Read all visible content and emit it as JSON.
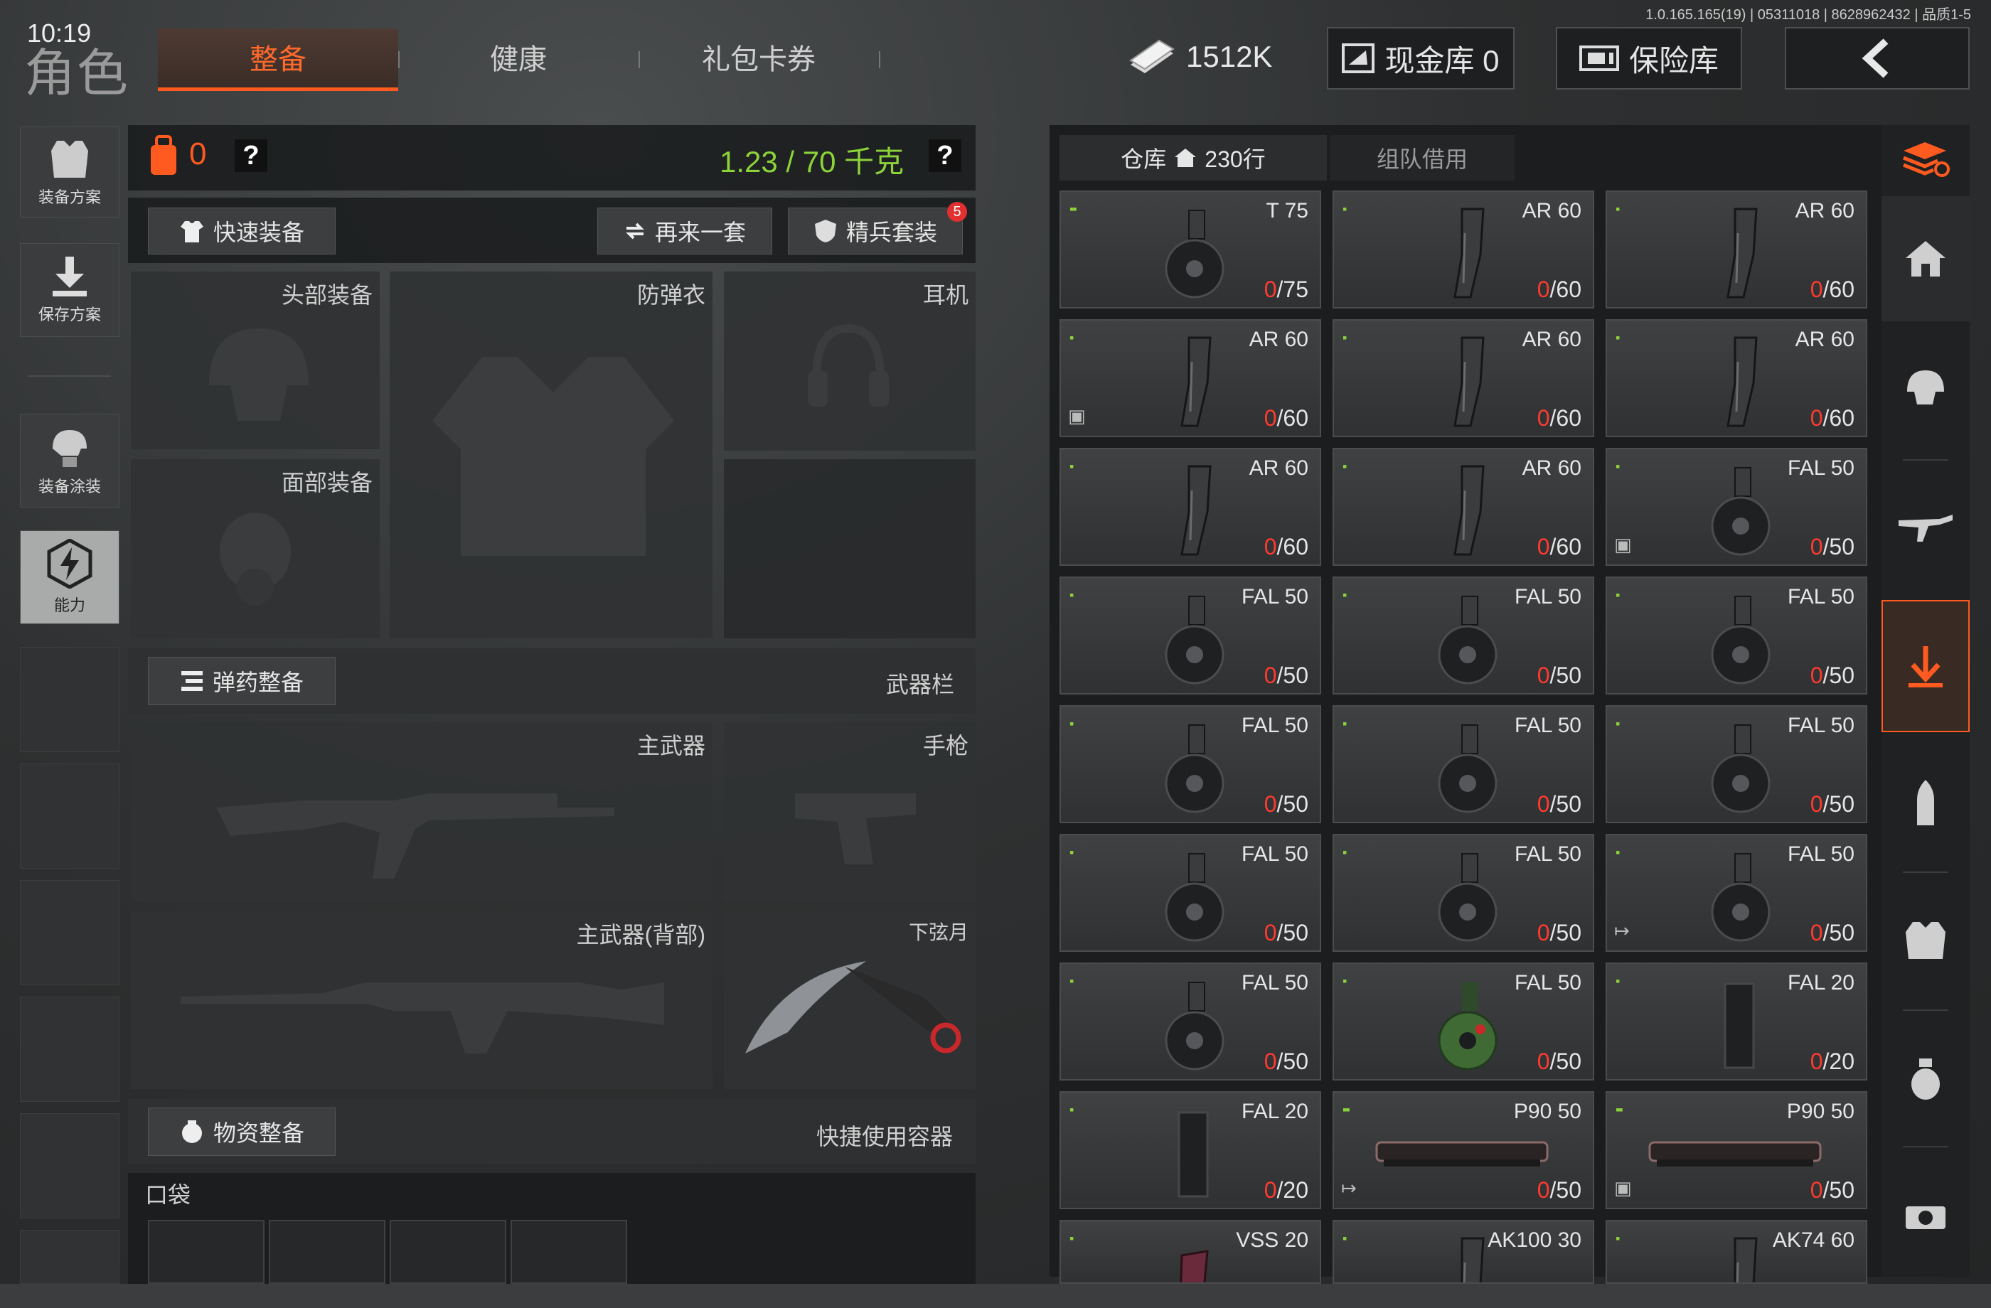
{
  "status": {
    "time": "10:19",
    "version": "1.0.165.165(19) | 05311018 | 8628962432 | 品质1-5"
  },
  "header": {
    "title": "角色",
    "tabs": [
      {
        "label": "整备",
        "active": true
      },
      {
        "label": "健康"
      },
      {
        "label": "礼包卡券"
      }
    ],
    "cash_amount": "1512K",
    "cash_vault_label": "现金库 0",
    "insurance_label": "保险库",
    "accent_color": "#ff5a20"
  },
  "sidebar": {
    "items": [
      {
        "label": "装备方案",
        "icon": "vest-plan-icon"
      },
      {
        "label": "保存方案",
        "icon": "download-icon"
      },
      {
        "label": "装备涂装",
        "icon": "helmet-paint-icon"
      },
      {
        "label": "能力",
        "icon": "ability-icon"
      }
    ]
  },
  "equip": {
    "backpack_count": "0",
    "help": "?",
    "weight": "1.23 / 70 千克",
    "weight_color": "#8cd33a",
    "quick_equip": "快速装备",
    "again": "再来一套",
    "elite": "精兵套装",
    "elite_badge": "5",
    "slots": {
      "head": "头部装备",
      "armor": "防弹衣",
      "headset": "耳机",
      "face": "面部装备",
      "primary": "主武器",
      "pistol": "手枪",
      "primary_back": "主武器(背部)",
      "melee": "下弦月"
    },
    "ammo_title": "弹药整备",
    "weapon_bar": "武器栏",
    "supplies_title": "物资整备",
    "quick_container": "快捷使用容器",
    "pocket": "口袋"
  },
  "inventory": {
    "tab_storage": "仓库",
    "rows": "230行",
    "tab_team": "组队借用",
    "items": [
      {
        "name": "T 75",
        "count": "0",
        "max": "/75",
        "shape": "drum",
        "tag": "▪▪"
      },
      {
        "name": "AR 60",
        "count": "0",
        "max": "/60",
        "shape": "mag",
        "tag": "▪"
      },
      {
        "name": "AR 60",
        "count": "0",
        "max": "/60",
        "shape": "mag",
        "tag": "▪"
      },
      {
        "name": "AR 60",
        "count": "0",
        "max": "/60",
        "shape": "mag",
        "tag": "▪",
        "mark": "▣"
      },
      {
        "name": "AR 60",
        "count": "0",
        "max": "/60",
        "shape": "mag",
        "tag": "▪"
      },
      {
        "name": "AR 60",
        "count": "0",
        "max": "/60",
        "shape": "mag",
        "tag": "▪"
      },
      {
        "name": "AR 60",
        "count": "0",
        "max": "/60",
        "shape": "mag",
        "tag": "▪"
      },
      {
        "name": "AR 60",
        "count": "0",
        "max": "/60",
        "shape": "mag",
        "tag": "▪"
      },
      {
        "name": "FAL 50",
        "count": "0",
        "max": "/50",
        "shape": "drum",
        "tag": "▪",
        "mark": "▣"
      },
      {
        "name": "FAL 50",
        "count": "0",
        "max": "/50",
        "shape": "drum",
        "tag": "▪"
      },
      {
        "name": "FAL 50",
        "count": "0",
        "max": "/50",
        "shape": "drum",
        "tag": "▪"
      },
      {
        "name": "FAL 50",
        "count": "0",
        "max": "/50",
        "shape": "drum",
        "tag": "▪"
      },
      {
        "name": "FAL 50",
        "count": "0",
        "max": "/50",
        "shape": "drum",
        "tag": "▪"
      },
      {
        "name": "FAL 50",
        "count": "0",
        "max": "/50",
        "shape": "drum",
        "tag": "▪"
      },
      {
        "name": "FAL 50",
        "count": "0",
        "max": "/50",
        "shape": "drum",
        "tag": "▪"
      },
      {
        "name": "FAL 50",
        "count": "0",
        "max": "/50",
        "shape": "drum",
        "tag": "▪"
      },
      {
        "name": "FAL 50",
        "count": "0",
        "max": "/50",
        "shape": "drum",
        "tag": "▪"
      },
      {
        "name": "FAL 50",
        "count": "0",
        "max": "/50",
        "shape": "drum",
        "tag": "▪",
        "mark": "↦"
      },
      {
        "name": "FAL 50",
        "count": "0",
        "max": "/50",
        "shape": "drum",
        "tag": "▪"
      },
      {
        "name": "FAL 50",
        "count": "0",
        "max": "/50",
        "shape": "drumgreen",
        "tag": "▪"
      },
      {
        "name": "FAL 20",
        "count": "0",
        "max": "/20",
        "shape": "box",
        "tag": "▪"
      },
      {
        "name": "FAL 20",
        "count": "0",
        "max": "/20",
        "shape": "box",
        "tag": "▪"
      },
      {
        "name": "P90 50",
        "count": "0",
        "max": "/50",
        "shape": "p90",
        "tag": "▪▪",
        "mark": "↦"
      },
      {
        "name": "P90 50",
        "count": "0",
        "max": "/50",
        "shape": "p90",
        "tag": "▪▪",
        "mark": "▣"
      },
      {
        "name": "VSS 20",
        "count": "",
        "max": "",
        "shape": "vss",
        "tag": "▪"
      },
      {
        "name": "AK100 30",
        "count": "",
        "max": "",
        "shape": "mag",
        "tag": "▪"
      },
      {
        "name": "AK74 60",
        "count": "",
        "max": "",
        "shape": "mag",
        "tag": "▪"
      }
    ]
  },
  "rail": {
    "items": [
      "stack-refresh-icon",
      "home-icon",
      "helmet-icon",
      "rifle-icon",
      "arrow-down-icon",
      "bullet-icon",
      "vest-icon",
      "grenade-icon",
      "camera-icon"
    ]
  }
}
